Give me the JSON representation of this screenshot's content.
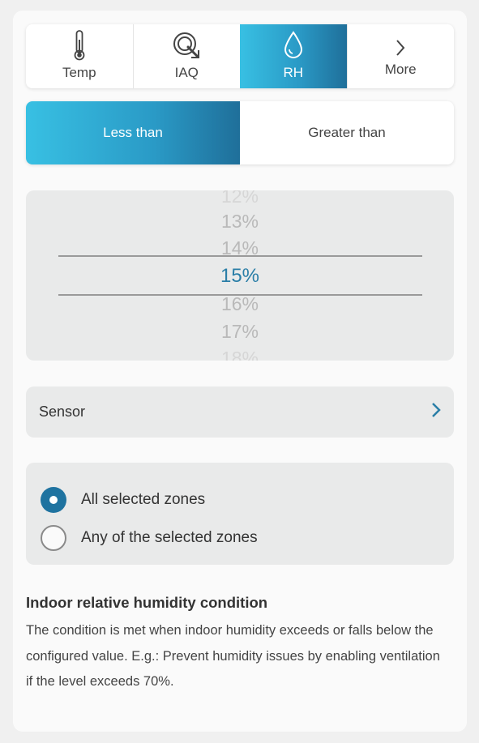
{
  "tabs": [
    {
      "label": "Temp",
      "icon": "thermometer-icon"
    },
    {
      "label": "IAQ",
      "icon": "air-quality-icon"
    },
    {
      "label": "RH",
      "icon": "droplet-icon",
      "active": true
    },
    {
      "label": "More",
      "icon": "chevron-right-icon"
    }
  ],
  "comparison": {
    "less_label": "Less than",
    "greater_label": "Greater than",
    "selected": "Less than"
  },
  "picker": {
    "items": [
      "12%",
      "13%",
      "14%",
      "15%",
      "16%",
      "17%",
      "18%"
    ],
    "selected": "15%"
  },
  "sensor": {
    "label": "Sensor"
  },
  "zones": {
    "options": [
      "All selected zones",
      "Any of the selected zones"
    ],
    "selected": "All selected zones"
  },
  "info": {
    "title": "Indoor relative humidity condition",
    "body": "The condition is met when indoor humidity exceeds or falls below the configured value. E.g.: Prevent humidity issues by enabling ventilation if the level exceeds 70%."
  },
  "colors": {
    "accent_start": "#38c0e3",
    "accent_end": "#1f6f9a",
    "selected_value": "#2a7ea7",
    "radio_on": "#1f73a0"
  }
}
